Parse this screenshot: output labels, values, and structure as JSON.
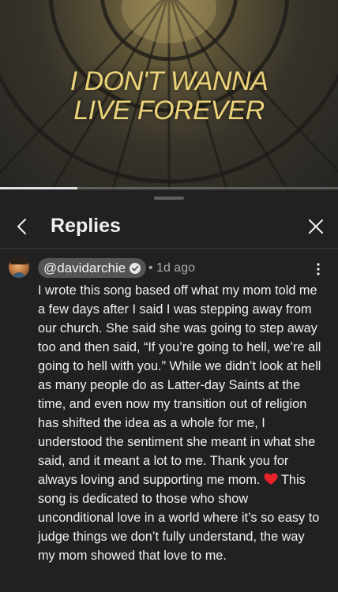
{
  "video": {
    "title_line1": "I DON'T WANNA",
    "title_line2": "LIVE FOREVER",
    "progress": 0.23
  },
  "panel": {
    "title": "Replies",
    "back_icon": "chevron-left-icon",
    "close_icon": "close-icon"
  },
  "comment": {
    "author": "@davidarchie",
    "verified_icon": "verified-check-icon",
    "time": "1d ago",
    "more_icon": "vertical-ellipsis-icon",
    "text_before_emoji": "I wrote this song based off what my mom told me a few days after I said I was stepping away from our church. She said she was going to step away too and then said, “If you’re going to hell, we’re all going to hell with you.” While we didn’t look at hell as many people do as Latter-day Saints at the time, and even now my transition out of religion has shifted the idea as a whole for me, I understood the sentiment she meant in what she said, and it meant a lot to me. Thank you for always loving and supporting me mom.",
    "emoji": "red-heart-icon",
    "text_after_emoji": "This song is dedicated to those who show unconditional love in a world where it’s so easy to judge things we don’t fully understand, the way my mom showed that love to me."
  },
  "colors": {
    "panel_bg": "#212121",
    "title_gold": "#ecd37a",
    "heart": "#e8222a"
  }
}
